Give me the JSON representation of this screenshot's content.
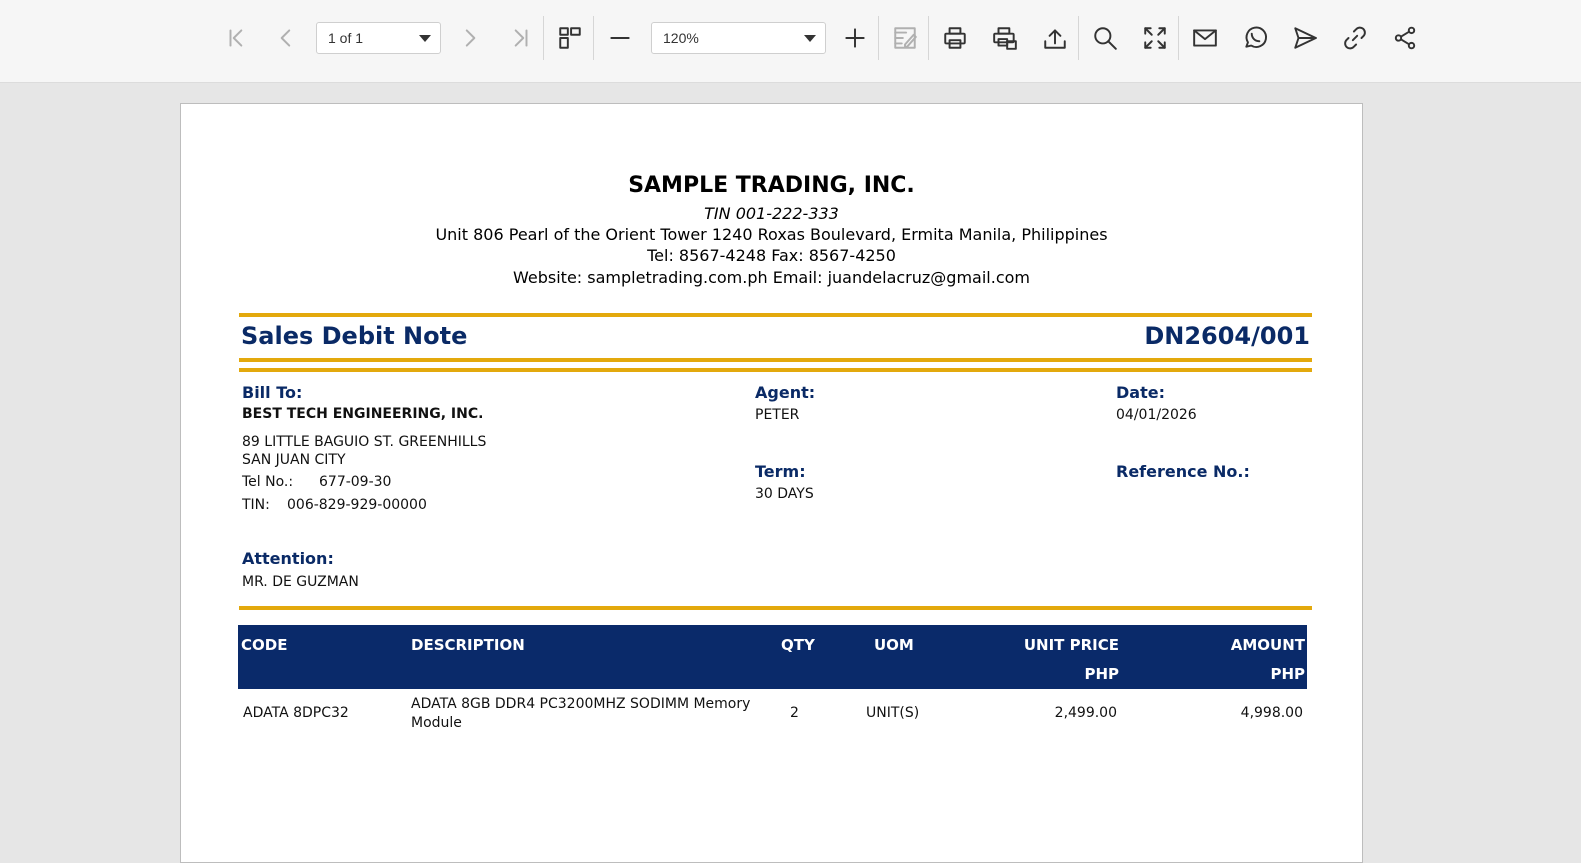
{
  "toolbar": {
    "page_select_value": "1 of 1",
    "zoom_select_value": "120%"
  },
  "document": {
    "company_name": "SAMPLE TRADING, INC.",
    "tin": "TIN 001-222-333",
    "address": "Unit 806 Pearl of the Orient Tower 1240 Roxas Boulevard, Ermita Manila, Philippines",
    "phone_fax": "Tel: 8567-4248  Fax: 8567-4250",
    "web_email": "Website: sampletrading.com.ph  Email: juandelacruz@gmail.com",
    "doc_type": "Sales Debit Note",
    "doc_number": "DN2604/001",
    "bill_to_label": "Bill To:",
    "customer_name": "BEST TECH ENGINEERING, INC.",
    "customer_addr1": "89 LITTLE BAGUIO ST. GREENHILLS",
    "customer_addr2": "SAN JUAN CITY",
    "tel_label": "Tel No.:",
    "tel_value": "677-09-30",
    "tin_label": "TIN:",
    "tin_value": "006-829-929-00000",
    "attention_label": "Attention:",
    "attention_value": "MR. DE GUZMAN",
    "agent_label": "Agent:",
    "agent_value": "PETER",
    "term_label": "Term:",
    "term_value": "30 DAYS",
    "date_label": "Date:",
    "date_value": "04/01/2026",
    "reference_label": "Reference No.:",
    "table": {
      "headers": [
        "CODE",
        "DESCRIPTION",
        "QTY",
        "UOM",
        "UNIT PRICE",
        "AMOUNT"
      ],
      "currency": "PHP",
      "rows": [
        {
          "code": "ADATA 8DPC32",
          "description_line1": "ADATA 8GB DDR4 PC3200MHZ SODIMM Memory",
          "description_line2": "Module",
          "qty": "2",
          "uom": "UNIT(S)",
          "unit_price": "2,499.00",
          "amount": "4,998.00"
        }
      ]
    }
  }
}
